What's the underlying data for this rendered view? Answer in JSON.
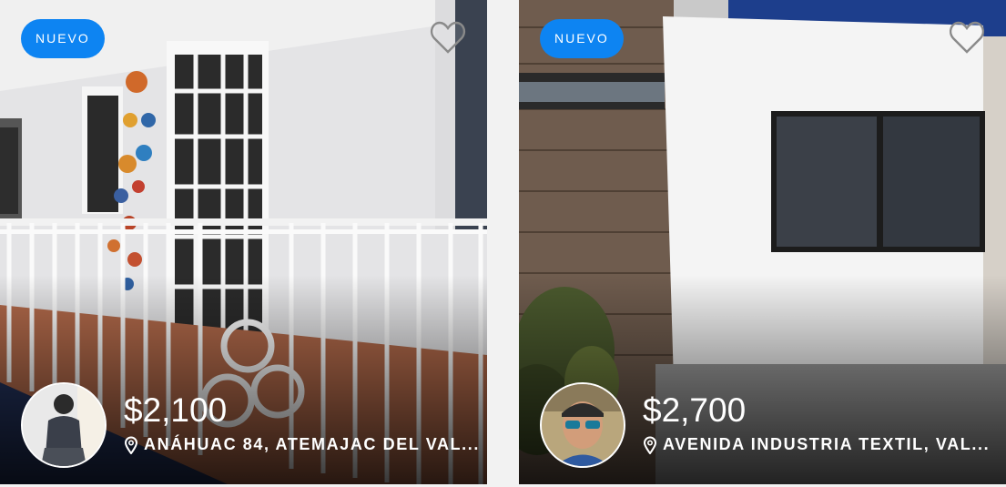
{
  "listings": [
    {
      "badge": "NUEVO",
      "price": "$2,100",
      "address": "ANÁHUAC 84, ATEMAJAC DEL VAL...",
      "favorite_icon": "heart-outline-icon",
      "location_icon": "map-pin-icon"
    },
    {
      "badge": "NUEVO",
      "price": "$2,700",
      "address": "AVENIDA INDUSTRIA TEXTIL, VAL...",
      "favorite_icon": "heart-outline-icon",
      "location_icon": "map-pin-icon"
    }
  ],
  "colors": {
    "badge": "#0d84f2",
    "text": "#ffffff"
  }
}
